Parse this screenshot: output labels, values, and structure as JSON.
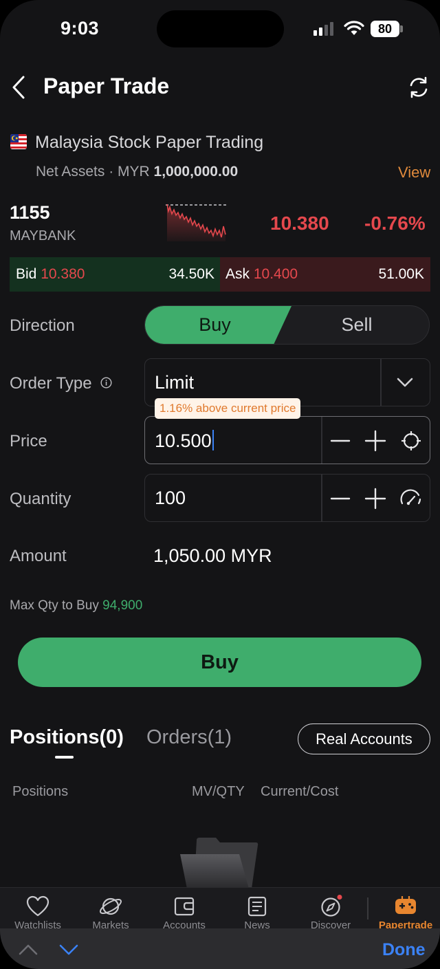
{
  "status_bar": {
    "time": "9:03",
    "battery": "80"
  },
  "header": {
    "title": "Paper Trade"
  },
  "account": {
    "name": "Malaysia Stock Paper Trading",
    "net_assets_label": "Net Assets · MYR",
    "net_assets_value": "1,000,000.00",
    "view_label": "View"
  },
  "quote": {
    "code": "1155",
    "name": "MAYBANK",
    "price": "10.380",
    "change_pct": "-0.76%",
    "bid_label": "Bid",
    "bid_price": "10.380",
    "bid_vol": "34.50K",
    "ask_label": "Ask",
    "ask_price": "10.400",
    "ask_vol": "51.00K"
  },
  "form": {
    "direction_label": "Direction",
    "buy_label": "Buy",
    "sell_label": "Sell",
    "order_type_label": "Order Type",
    "order_type_value": "Limit",
    "price_label": "Price",
    "price_value": "10.500",
    "price_hint": "1.16% above current price",
    "quantity_label": "Quantity",
    "quantity_value": "100",
    "amount_label": "Amount",
    "amount_value": "1,050.00 MYR",
    "max_qty_label": "Max Qty to Buy",
    "max_qty_value": "94,900",
    "submit_label": "Buy"
  },
  "tabs": {
    "positions": "Positions(0)",
    "orders": "Orders(1)",
    "real_accounts": "Real Accounts"
  },
  "columns": {
    "positions": "Positions",
    "mv_qty": "MV/QTY",
    "current_cost": "Current/Cost"
  },
  "nav": [
    {
      "label": "Watchlists",
      "icon": "heart-icon"
    },
    {
      "label": "Markets",
      "icon": "planet-icon"
    },
    {
      "label": "Accounts",
      "icon": "wallet-icon"
    },
    {
      "label": "News",
      "icon": "news-icon"
    },
    {
      "label": "Discover",
      "icon": "compass-icon"
    },
    {
      "label": "Papertrade",
      "icon": "gamepad-icon"
    }
  ],
  "keyboard": {
    "done_label": "Done"
  },
  "colors": {
    "accent_green": "#3fad6c",
    "down_red": "#e5484d",
    "link_orange": "#e08a3c",
    "focus_blue": "#3b82f6"
  }
}
